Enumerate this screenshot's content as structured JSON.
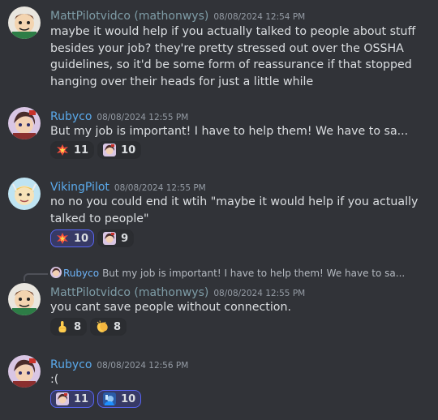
{
  "colors": {
    "background": "#313338",
    "matt_name": "#7e9ca6",
    "rubyco_name": "#5aa9ea",
    "viking_name": "#5aa9ea",
    "timestamp": "#949ba4",
    "reaction_selected_border": "#5865f2"
  },
  "messages": [
    {
      "author": "MattPilotvidco (mathonwys)",
      "timestamp": "08/08/2024 12:54 PM",
      "text": "maybe it would help if you actually talked to people about stuff besides your job? they're pretty stressed out over the OSSHA guidelines, so it'd be some form of reassurance if that stopped hanging over their heads for just a little while"
    },
    {
      "author": "Rubyco",
      "timestamp": "08/08/2024 12:55 PM",
      "text": "But my job is important! I have to help them! We have to sa...",
      "reactions": [
        {
          "emoji": "collision-emoji",
          "count": "11",
          "selected": false
        },
        {
          "emoji": "custom-character-emoji",
          "count": "10",
          "selected": false
        }
      ]
    },
    {
      "author": "VikingPilot",
      "timestamp": "08/08/2024 12:55 PM",
      "text": "no no you could end it wtih \"maybe it would help if you actually talked to people\"",
      "reactions": [
        {
          "emoji": "collision-emoji",
          "count": "10",
          "selected": true
        },
        {
          "emoji": "custom-character-emoji",
          "count": "9",
          "selected": false
        }
      ]
    },
    {
      "reply_to": {
        "author": "Rubyco",
        "text": "But my job is important! I have to help them! We have to sa..."
      },
      "author": "MattPilotvidco (mathonwys)",
      "timestamp": "08/08/2024 12:55 PM",
      "text": "you cant save people without connection.",
      "reactions": [
        {
          "emoji": "point-up-emoji",
          "count": "8",
          "selected": false
        },
        {
          "emoji": "clapping-hands-emoji",
          "count": "8",
          "selected": false
        }
      ]
    },
    {
      "author": "Rubyco",
      "timestamp": "08/08/2024 12:56 PM",
      "text": ":(",
      "reactions": [
        {
          "emoji": "custom-character-emoji",
          "count": "11",
          "selected": true
        },
        {
          "emoji": "custom-blue-character-emoji",
          "count": "10",
          "selected": true
        }
      ]
    }
  ]
}
